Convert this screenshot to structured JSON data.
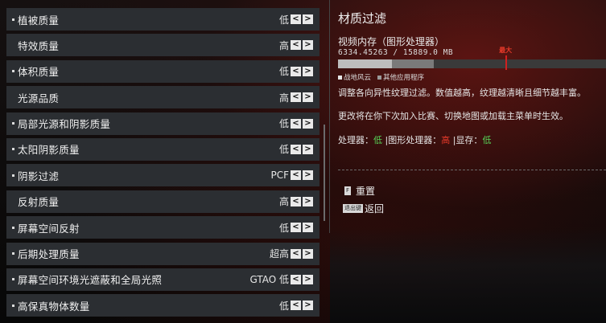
{
  "settings": [
    {
      "label": "植被质量",
      "value": "低",
      "bullet": true
    },
    {
      "label": "特效质量",
      "value": "高",
      "bullet": false
    },
    {
      "label": "体积质量",
      "value": "低",
      "bullet": true
    },
    {
      "label": "光源品质",
      "value": "高",
      "bullet": false
    },
    {
      "label": "局部光源和阴影质量",
      "value": "低",
      "bullet": true
    },
    {
      "label": "太阳阴影质量",
      "value": "低",
      "bullet": true
    },
    {
      "label": "阴影过滤",
      "value": "PCF",
      "bullet": true
    },
    {
      "label": "反射质量",
      "value": "高",
      "bullet": false
    },
    {
      "label": "屏幕空间反射",
      "value": "低",
      "bullet": true
    },
    {
      "label": "后期处理质量",
      "value": "超高",
      "bullet": true
    },
    {
      "label": "屏幕空间环境光遮蔽和全局光照",
      "value": "GTAO 低",
      "bullet": true
    },
    {
      "label": "高保真物体数量",
      "value": "低",
      "bullet": true
    }
  ],
  "arrows": {
    "left": "<",
    "right": ">"
  },
  "panel": {
    "title": "材质过滤",
    "vram_label": "视频内存（图形处理器）",
    "vram_value": "6334.45263 / 15889.0 MB",
    "vram_used_fraction": 0.2,
    "vram_other_fraction": 0.158,
    "vram_max_fraction": 0.625,
    "max_label": "最大",
    "legend_game": "战地风云",
    "legend_other": "其他应用程序",
    "description": "调整各向异性纹理过滤。数值越高，纹理越清晰且细节越丰富。",
    "note": "更改将在你下次加入比赛、切换地图或加载主菜单时生效。",
    "impact_cpu_label": "处理器：",
    "impact_cpu": "低",
    "impact_gpu_label": "图形处理器：",
    "impact_gpu": "高",
    "impact_vram_label": "显存：",
    "impact_vram": "低",
    "sep": "|"
  },
  "buttons": {
    "reset_key": "F",
    "reset_label": "重置",
    "back_key": "退出键",
    "back_label": "返回"
  },
  "colors": {
    "low": "#57d357",
    "high": "#e83a2a",
    "accent_red": "#d12020"
  }
}
